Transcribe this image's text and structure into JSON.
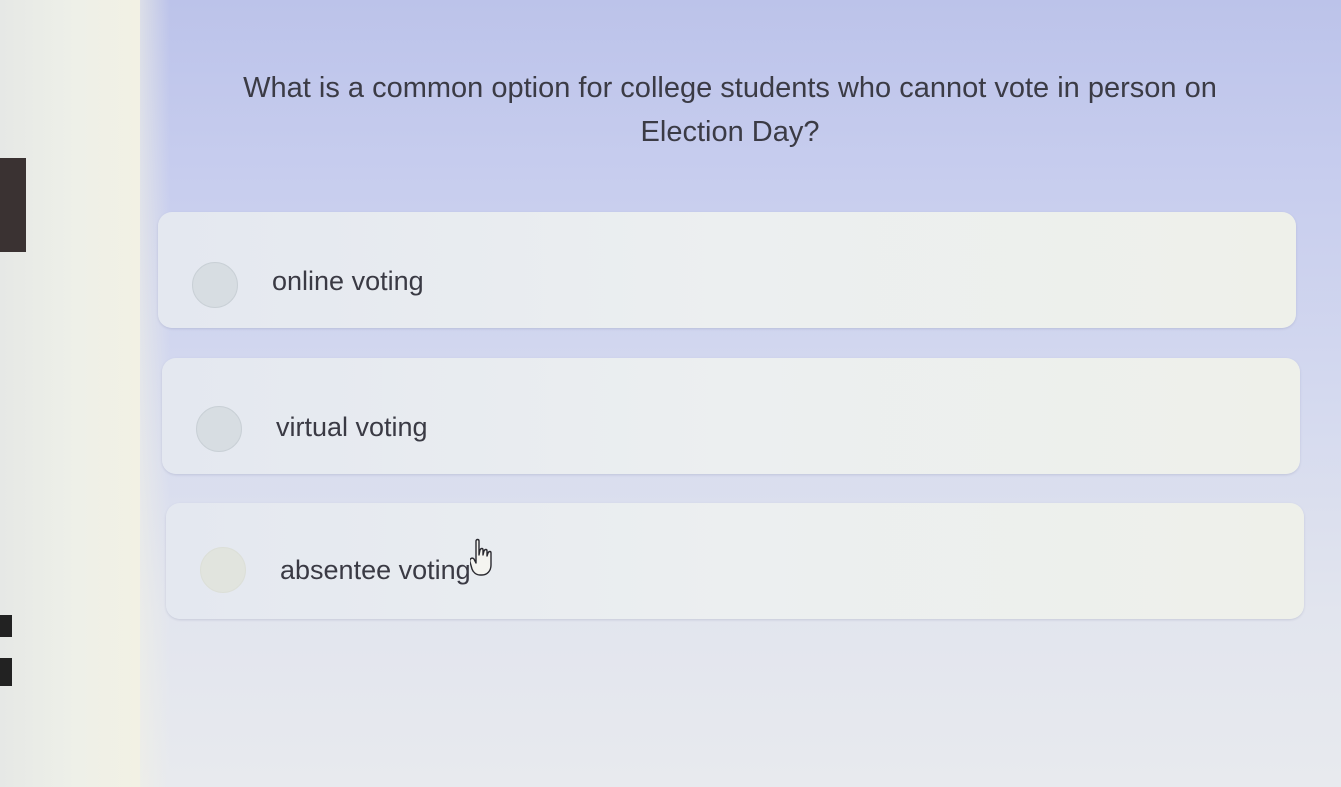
{
  "question": {
    "text": "What is a common option for college students who cannot vote in person on Election Day?"
  },
  "options": [
    {
      "label": "online voting",
      "selected": false
    },
    {
      "label": "virtual voting",
      "selected": false
    },
    {
      "label": "absentee voting",
      "selected": false
    }
  ],
  "colors": {
    "background_top": "#bcc3ea",
    "option_card": "#eceff0",
    "radio": "#d7dde2",
    "text": "#3b3b45"
  }
}
